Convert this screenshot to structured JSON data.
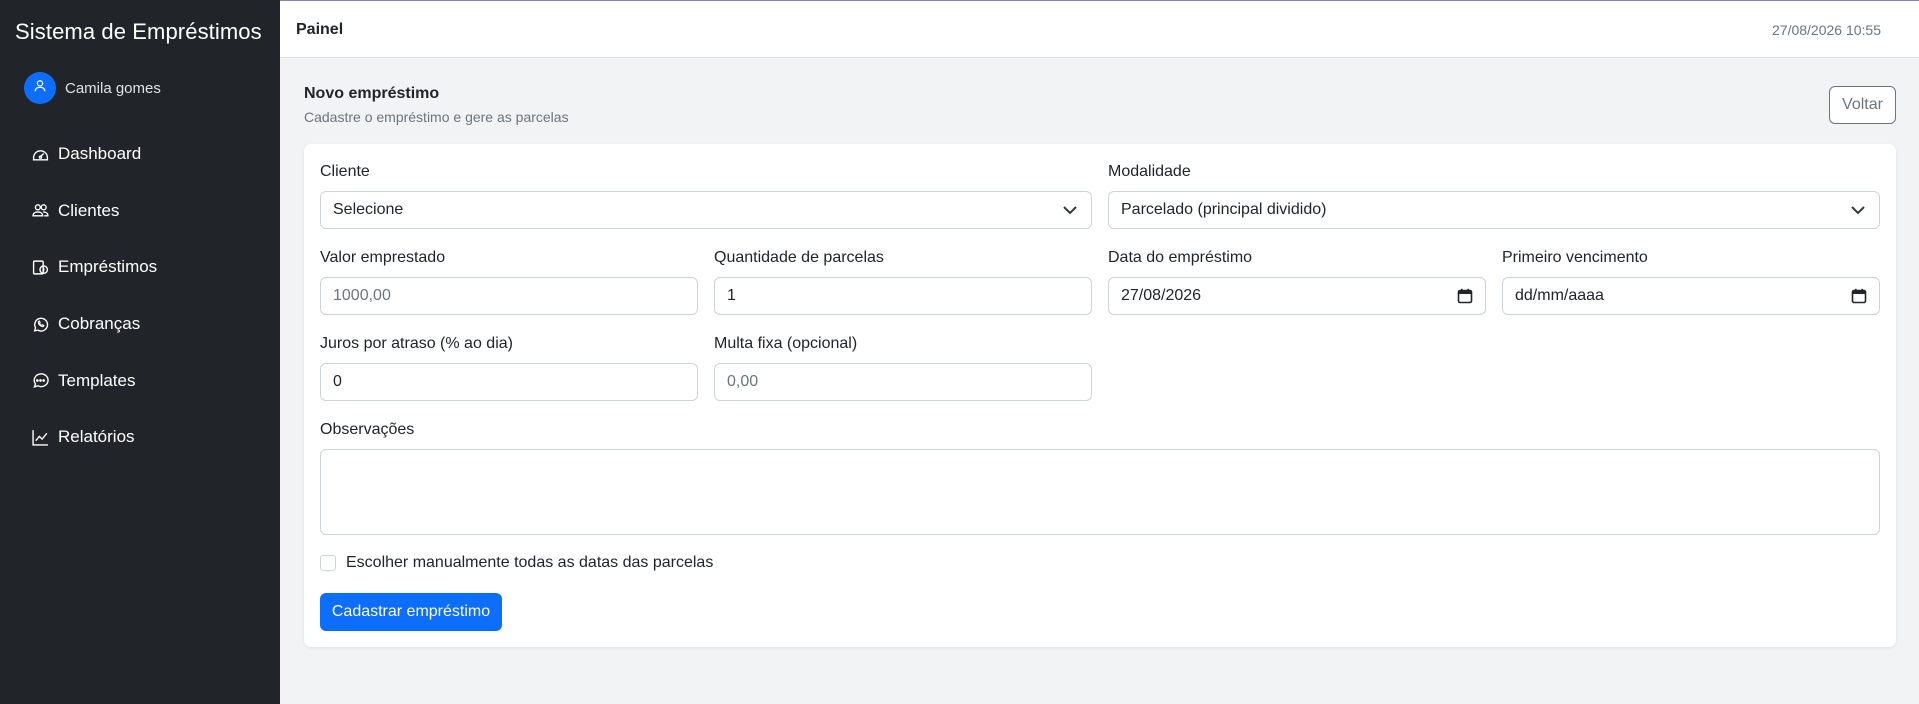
{
  "sidebar": {
    "brand": "Sistema de Empréstimos",
    "user": {
      "name": "Camila gomes",
      "icon": "user-icon"
    },
    "items": [
      {
        "label": "Dashboard",
        "icon": "speedometer-icon"
      },
      {
        "label": "Clientes",
        "icon": "people-icon"
      },
      {
        "label": "Empréstimos",
        "icon": "cash-icon"
      },
      {
        "label": "Cobranças",
        "icon": "whatsapp-icon"
      },
      {
        "label": "Templates",
        "icon": "chat-dots-icon"
      },
      {
        "label": "Relatórios",
        "icon": "graph-up-icon"
      }
    ]
  },
  "topbar": {
    "title": "Painel",
    "datetime": "27/08/2026 10:55"
  },
  "page": {
    "title": "Novo empréstimo",
    "subtitle": "Cadastre o empréstimo e gere as parcelas",
    "back_label": "Voltar"
  },
  "form": {
    "cliente": {
      "label": "Cliente",
      "value": "Selecione"
    },
    "modalidade": {
      "label": "Modalidade",
      "value": "Parcelado (principal dividido)"
    },
    "valor": {
      "label": "Valor emprestado",
      "placeholder": "1000,00"
    },
    "parcelas": {
      "label": "Quantidade de parcelas",
      "value": "1"
    },
    "data_emprestimo": {
      "label": "Data do empréstimo",
      "value": "27/08/2026"
    },
    "primeiro_vencimento": {
      "label": "Primeiro vencimento",
      "value": "dd/mm/aaaa"
    },
    "juros": {
      "label": "Juros por atraso (% ao dia)",
      "value": "0"
    },
    "multa": {
      "label": "Multa fixa (opcional)",
      "placeholder": "0,00"
    },
    "observacoes": {
      "label": "Observações",
      "value": ""
    },
    "manual_dates": {
      "label": "Escolher manualmente todas as datas das parcelas",
      "checked": false
    },
    "submit_label": "Cadastrar empréstimo"
  },
  "colors": {
    "sidebar_bg": "#212529",
    "primary": "#0d6efd",
    "page_bg": "#f1f3f5"
  }
}
